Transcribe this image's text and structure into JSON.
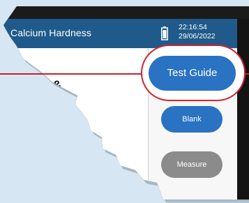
{
  "header": {
    "title": "Calcium Hardness",
    "time": "22:16:54",
    "date": "29/06/2022"
  },
  "main": {
    "partial_text": "ple &"
  },
  "sidebar": {
    "test_guide_label": "Test Guide",
    "blank_label": "Blank",
    "measure_label": "Measure"
  },
  "icons": {
    "battery": "battery-icon"
  },
  "colors": {
    "header_bg": "#1f5a8a",
    "primary_button": "#2a72c2",
    "disabled_button": "#8b8b8b",
    "highlight": "#d2232f",
    "background": "#d6e6f2"
  }
}
